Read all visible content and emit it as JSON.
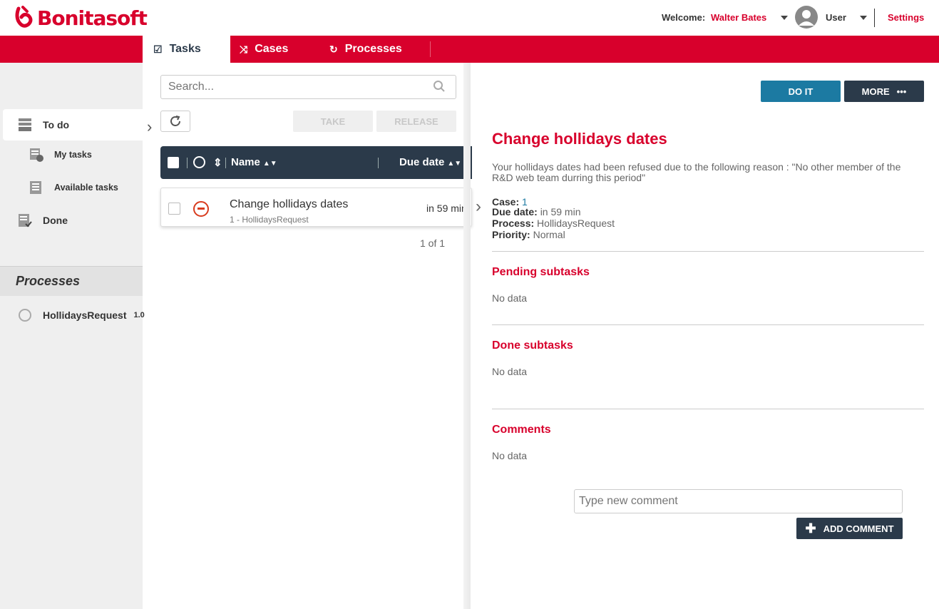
{
  "header": {
    "logo_text": "Bonitasoft",
    "welcome_label": "Welcome:",
    "user_name": "Walter Bates",
    "profile_label": "User",
    "settings_label": "Settings"
  },
  "tabs": [
    {
      "label": "Tasks",
      "icon": "check-square-icon"
    },
    {
      "label": "Cases",
      "icon": "shuffle-icon"
    },
    {
      "label": "Processes",
      "icon": "cycle-icon"
    }
  ],
  "sidebar": {
    "todo": "To do",
    "my_tasks": "My tasks",
    "available_tasks": "Available tasks",
    "done": "Done",
    "processes_header": "Processes",
    "process_name": "HollidaysRequest",
    "process_version": "1.0"
  },
  "list": {
    "search_placeholder": "Search...",
    "take_label": "TAKE",
    "release_label": "RELEASE",
    "col_name": "Name",
    "col_due": "Due date",
    "rows": [
      {
        "name": "Change hollidays dates",
        "sub": "1 - HollidaysRequest",
        "due": "in 59 min",
        "priority": "high"
      }
    ],
    "pager": "1 of 1"
  },
  "detail": {
    "doit_label": "DO IT",
    "more_label": "MORE",
    "title": "Change hollidays dates",
    "description": "Your hollidays dates had been refused due to the following reason : \"No other member of the R&D web team durring this period\"",
    "case_label": "Case:",
    "case_value": "1",
    "due_label": "Due date:",
    "due_value": "in 59 min",
    "process_label": "Process:",
    "process_value": "HollidaysRequest",
    "priority_label": "Priority:",
    "priority_value": "Normal",
    "pending_title": "Pending subtasks",
    "pending_empty": "No data",
    "done_title": "Done subtasks",
    "done_empty": "No data",
    "comments_title": "Comments",
    "comments_empty": "No data",
    "comment_placeholder": "Type new comment",
    "add_comment_label": "ADD COMMENT"
  },
  "colors": {
    "brand_red": "#d8002c",
    "navy": "#2b3a4a",
    "action_blue": "#1c7aa2"
  }
}
